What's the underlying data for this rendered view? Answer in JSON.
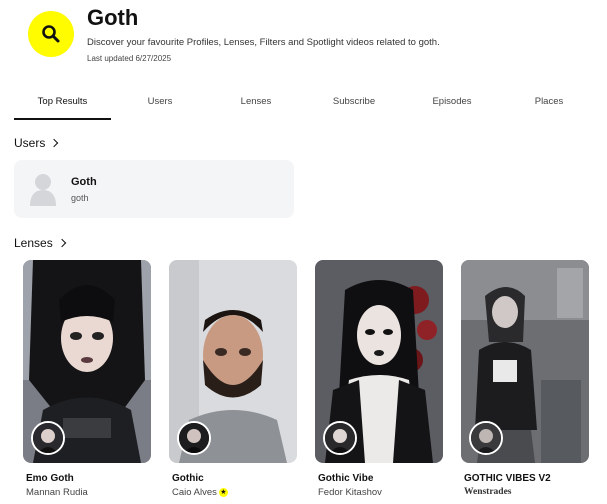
{
  "header": {
    "title": "Goth",
    "description": "Discover your favourite Profiles, Lenses, Filters and Spotlight videos related to goth.",
    "last_updated": "Last updated 6/27/2025",
    "icon": "search-icon",
    "badge_color": "#fffc00"
  },
  "tabs": [
    {
      "label": "Top Results",
      "active": true
    },
    {
      "label": "Users",
      "active": false
    },
    {
      "label": "Lenses",
      "active": false
    },
    {
      "label": "Subscribe",
      "active": false
    },
    {
      "label": "Episodes",
      "active": false
    },
    {
      "label": "Places",
      "active": false
    }
  ],
  "sections": {
    "users_title": "Users",
    "lenses_title": "Lenses"
  },
  "users": [
    {
      "name": "Goth",
      "handle": "goth",
      "avatar": "default-avatar-icon"
    }
  ],
  "lenses": [
    {
      "name": "Emo Goth",
      "creator": "Mannan Rudia",
      "verified": false
    },
    {
      "name": "Gothic",
      "creator": "Caio Alves",
      "verified": true
    },
    {
      "name": "Gothic Vibe",
      "creator": "Fedor Kitashov",
      "verified": false
    },
    {
      "name": "GOTHIC VIBES V2",
      "creator": "Wenstrades",
      "verified": false
    }
  ]
}
